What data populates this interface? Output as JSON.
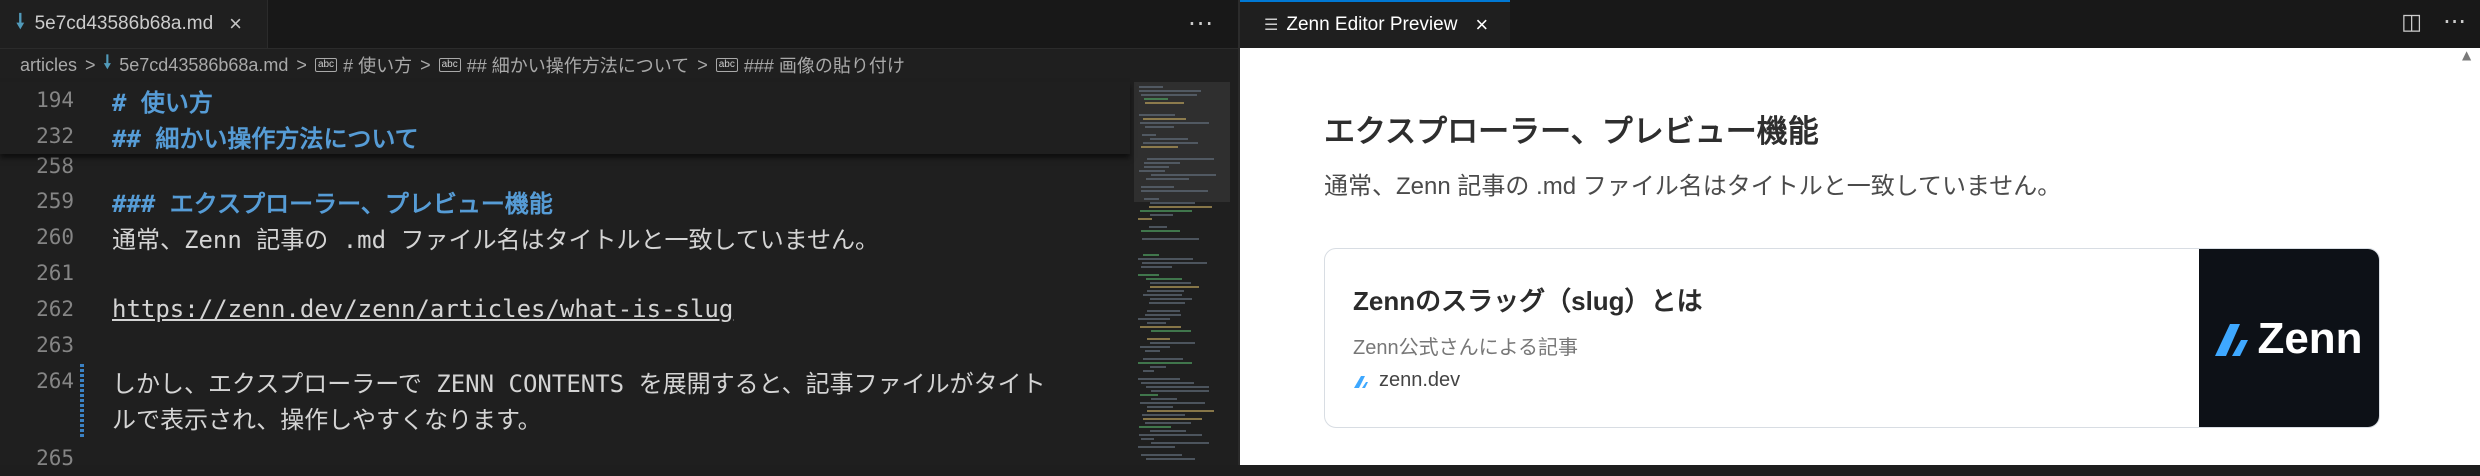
{
  "editor": {
    "tab": {
      "filename": "5e7cd43586b68a.md",
      "close": "×"
    },
    "more": "···",
    "breadcrumb": {
      "root": "articles",
      "file": "5e7cd43586b68a.md",
      "h1": "# 使い方",
      "h2": "## 細かい操作方法について",
      "h3": "### 画像の貼り付け"
    },
    "sticky": [
      {
        "num": "194",
        "text": "# 使い方"
      },
      {
        "num": "232",
        "text": "## 細かい操作方法について"
      }
    ],
    "lines": [
      {
        "num": "258",
        "text": ""
      },
      {
        "num": "259",
        "text": "### エクスプローラー、プレビュー機能"
      },
      {
        "num": "260",
        "text": "通常、Zenn 記事の .md ファイル名はタイトルと一致していません。"
      },
      {
        "num": "261",
        "text": ""
      },
      {
        "num": "262",
        "text": "https://zenn.dev/zenn/articles/what-is-slug"
      },
      {
        "num": "263",
        "text": ""
      },
      {
        "num": "264",
        "text": "しかし、エクスプローラーで ZENN CONTENTS を展開すると、記事ファイルがタイト"
      },
      {
        "num": "",
        "text": "ルで表示され、操作しやすくなります。"
      },
      {
        "num": "265",
        "text": ""
      }
    ]
  },
  "preview": {
    "tab": {
      "label": "Zenn Editor Preview",
      "close": "×"
    },
    "more": "···",
    "heading": "エクスプローラー、プレビュー機能",
    "paragraph": "通常、Zenn 記事の .md ファイル名はタイトルと一致していません。",
    "card": {
      "title": "Zennのスラッグ（slug）とは",
      "description": "Zenn公式さんによる記事",
      "host": "zenn.dev",
      "thumb_logo": "Zenn"
    }
  },
  "colors": {
    "accent": "#0078d4",
    "heading": "#569cd6",
    "zenn_blue": "#3ea8ff",
    "thumb_bg": "#0d1117"
  }
}
